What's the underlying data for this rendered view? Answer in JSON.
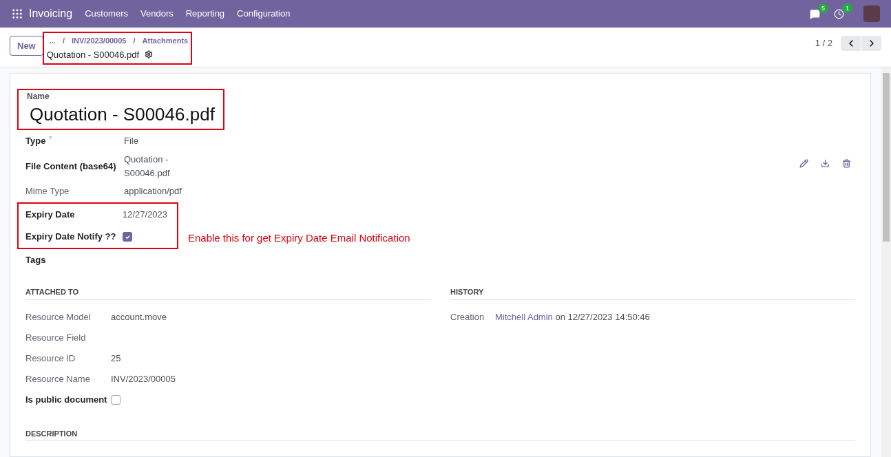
{
  "navbar": {
    "app": "Invoicing",
    "menu": [
      "Customers",
      "Vendors",
      "Reporting",
      "Configuration"
    ],
    "messages_count": "5",
    "activities_count": "1"
  },
  "control_panel": {
    "new_button": "New",
    "breadcrumb": {
      "highlighted": true,
      "ellipsis": "...",
      "separator": "/",
      "items": [
        "INV/2023/00005",
        "Attachments"
      ],
      "current": "Quotation - S00046.pdf"
    },
    "pager": "1 / 2"
  },
  "form": {
    "name": {
      "label": "Name",
      "value": "Quotation - S00046.pdf",
      "highlighted": true
    },
    "fields": [
      {
        "kind": "text",
        "label": "Type",
        "help": "?",
        "value": "File",
        "readonly": false,
        "highlighted": false
      },
      {
        "kind": "file",
        "label": "File Content (base64)",
        "value": "Quotation - S00046.pdf",
        "readonly": false,
        "highlighted": false
      },
      {
        "kind": "text",
        "label": "Mime Type",
        "value": "application/pdf",
        "readonly": true,
        "highlighted": false
      },
      {
        "kind": "text",
        "label": "Expiry Date",
        "value": "12/27/2023",
        "readonly": false,
        "highlighted": true
      },
      {
        "kind": "checkbox",
        "label": "Expiry Date Notify ??",
        "checked": true,
        "readonly": false,
        "highlighted": true,
        "note": "Enable this for get Expiry Date Email Notification"
      },
      {
        "kind": "text",
        "label": "Tags",
        "readonly": false,
        "highlighted": false
      }
    ],
    "attached_to": {
      "title": "ATTACHED TO",
      "fields": [
        {
          "kind": "text",
          "label": "Resource Model",
          "value": "account.move",
          "readonly": true
        },
        {
          "kind": "text",
          "label": "Resource Field",
          "readonly": true
        },
        {
          "kind": "text",
          "label": "Resource ID",
          "value": "25",
          "readonly": true
        },
        {
          "kind": "text",
          "label": "Resource Name",
          "value": "INV/2023/00005",
          "readonly": true
        },
        {
          "kind": "checkbox",
          "label": "Is public document",
          "checked": false,
          "readonly": false
        }
      ]
    },
    "history": {
      "title": "HISTORY",
      "label": "Creation",
      "user": "Mitchell Admin",
      "rest": "on 12/27/2023 14:50:46"
    },
    "description": {
      "title": "DESCRIPTION"
    }
  }
}
